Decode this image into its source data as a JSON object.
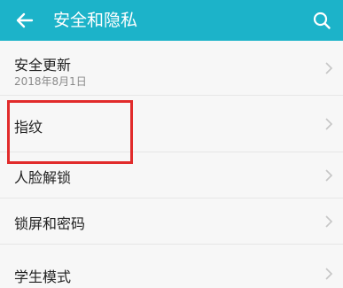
{
  "header": {
    "title": "安全和隐私",
    "back_icon": "arrow-left-icon",
    "search_icon": "search-icon",
    "color": "#1cb3c9"
  },
  "list": {
    "items": [
      {
        "label": "安全更新",
        "subtitle": "2018年8月1日"
      },
      {
        "label": "指纹"
      },
      {
        "label": "人脸解锁"
      },
      {
        "label": "锁屏和密码"
      },
      {
        "label": "学生模式"
      }
    ]
  },
  "annotation": {
    "color": "#e12b2b"
  }
}
